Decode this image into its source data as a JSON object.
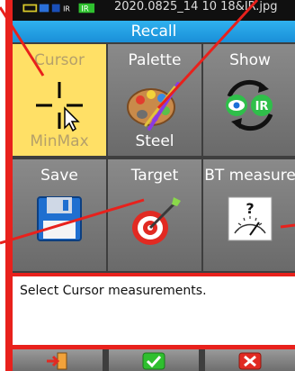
{
  "status": {
    "text": "2020.0825_14 10 18&IR.jpg"
  },
  "title": "Recall",
  "tiles": [
    {
      "label": "Cursor",
      "sub": "MinMax",
      "selected": true
    },
    {
      "label": "Palette",
      "sub": "Steel",
      "selected": false
    },
    {
      "label": "Show",
      "sub": "",
      "selected": false
    },
    {
      "label": "Save",
      "sub": "",
      "selected": false
    },
    {
      "label": "Target",
      "sub": "",
      "selected": false
    },
    {
      "label": "BT measure",
      "sub": "",
      "selected": false
    }
  ],
  "message": "Select Cursor measurements.",
  "show_icon_text": "IR",
  "colors": {
    "frame": "#e8211c",
    "title_bar": "#1a8fd8",
    "selected_tile": "#ffe066"
  },
  "icons": {
    "cursor": "crosshair-cursor-icon",
    "palette": "paint-palette-icon",
    "show": "eye-ir-toggle-icon",
    "save": "floppy-disk-icon",
    "target": "target-dart-icon",
    "bt_measure": "gauge-question-icon",
    "exit": "exit-door-icon",
    "ok": "green-check-icon",
    "cancel": "red-x-icon"
  }
}
